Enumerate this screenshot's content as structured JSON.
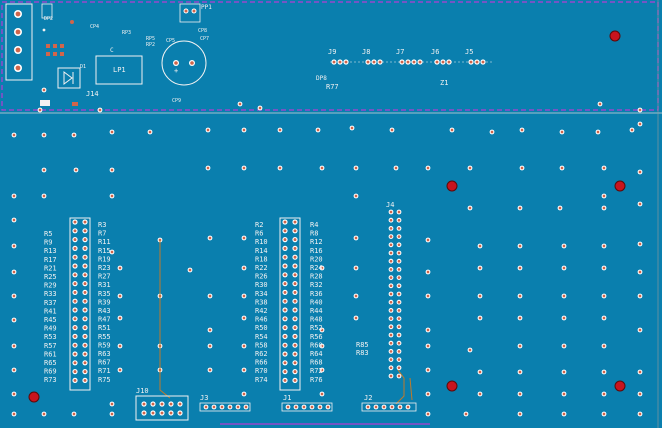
{
  "colors": {
    "board": "#0a7fae",
    "silk": "#f2f2f2",
    "outline": "#b43cd2",
    "copper": "#d1654a",
    "mount_hole": "#c8141e",
    "trace": "#c07a2a"
  },
  "top_section": {
    "labels": {
      "DP2": "DP2",
      "CP4": "CP4",
      "RP3": "RP3",
      "PP1": "PP1",
      "CP8": "CP8",
      "CP7": "CP7",
      "CP6": "CP6",
      "RP5": "RP5",
      "RP2": "RP2",
      "CP5": "CP5",
      "LP1": "LP1",
      "D1": "D1",
      "J14": "J14",
      "CP9": "CP9",
      "J9": "J9",
      "J8": "J8",
      "J7": "J7",
      "J6": "J6",
      "J5": "J5",
      "DP8": "DP8",
      "R77": "R77",
      "Z1": "Z1"
    }
  },
  "left_column_labels": [
    "R5",
    "R9",
    "R13",
    "R17",
    "R21",
    "R25",
    "R29",
    "R33",
    "R37",
    "R41",
    "R45",
    "R49",
    "R53",
    "R57",
    "R61",
    "R65",
    "R69",
    "R73"
  ],
  "left_column_labels_b": [
    "R3",
    "R7",
    "R11",
    "R15",
    "R19",
    "R23",
    "R27",
    "R31",
    "R35",
    "R39",
    "R43",
    "R47",
    "R51",
    "R55",
    "R59",
    "R63",
    "R67",
    "R71",
    "R75"
  ],
  "mid_column_labels_a": [
    "R2",
    "R6",
    "R10",
    "R14",
    "R18",
    "R22",
    "R26",
    "R30",
    "R34",
    "R38",
    "R42",
    "R46",
    "R50",
    "R54",
    "R58",
    "R62",
    "R66",
    "R70",
    "R74"
  ],
  "mid_column_labels_b": [
    "R4",
    "R8",
    "R12",
    "R16",
    "R20",
    "R24",
    "R28",
    "R32",
    "R36",
    "R40",
    "R44",
    "R48",
    "R52",
    "R56",
    "R60",
    "R64",
    "R68",
    "R72",
    "R76"
  ],
  "connectors": {
    "J4": "J4",
    "J10": "J10",
    "J3": "J3",
    "J1": "J1",
    "J2": "J2",
    "R85": "R85",
    "R83": "R83"
  }
}
